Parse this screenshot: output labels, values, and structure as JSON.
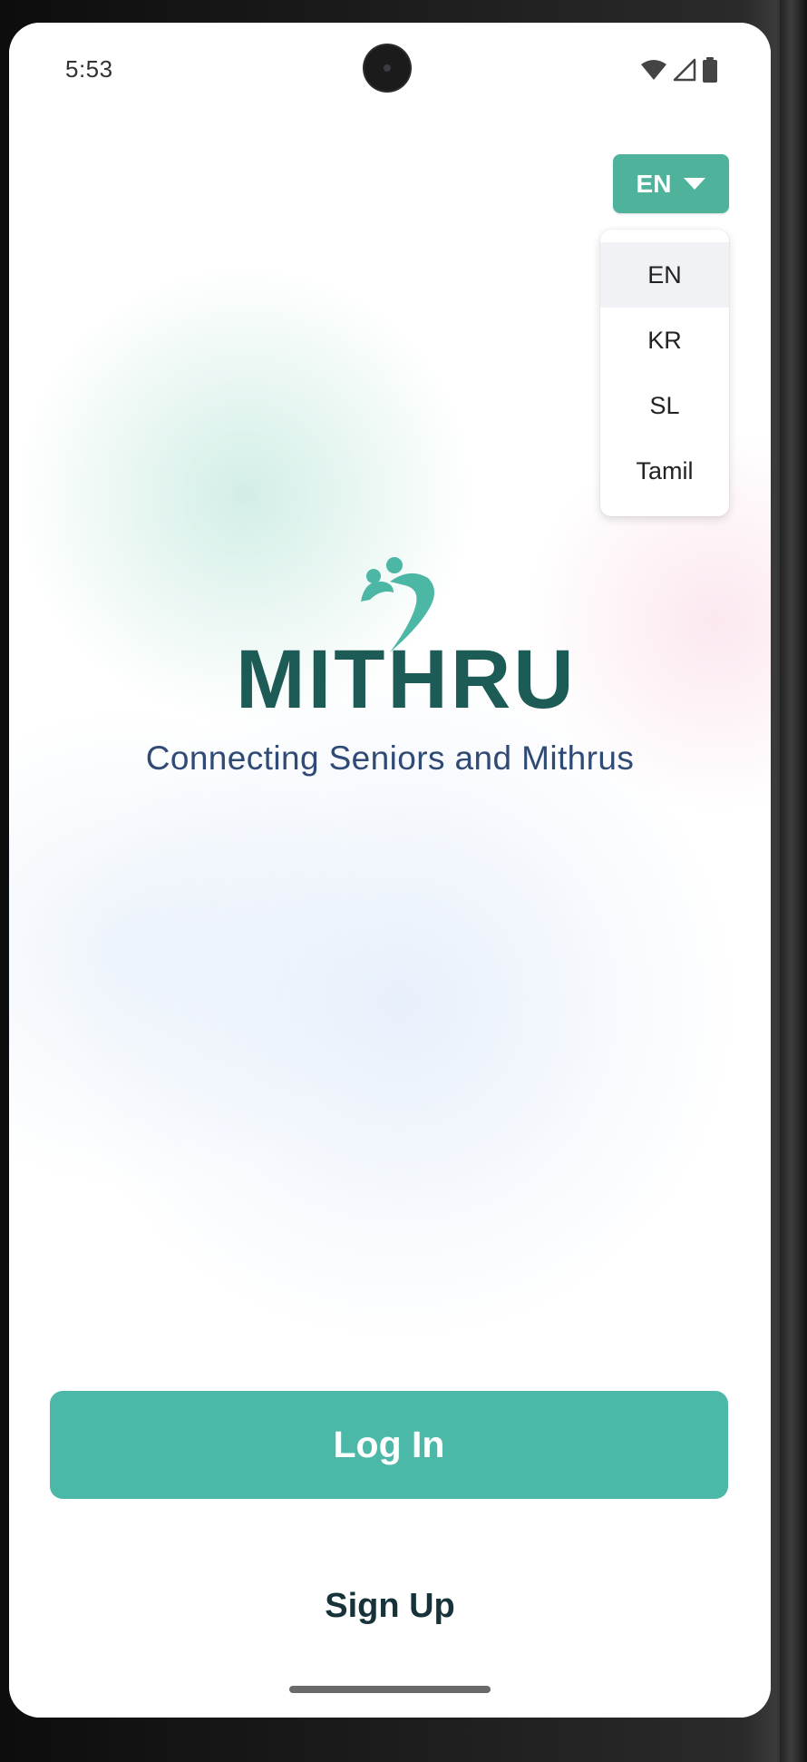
{
  "status_bar": {
    "time": "5:53",
    "icons": [
      "wifi-icon",
      "cell-signal-icon",
      "battery-icon"
    ]
  },
  "language": {
    "current": "EN",
    "options": [
      "EN",
      "KR",
      "SL",
      "Tamil"
    ],
    "selected_index": 0
  },
  "brand": {
    "logo_text": "MITHRU",
    "tagline": "Connecting Seniors and Mithrus"
  },
  "actions": {
    "login_label": "Log In",
    "signup_label": "Sign Up"
  },
  "colors": {
    "primary": "#4cb8a8",
    "logo_dark": "#1d5b57",
    "tagline": "#2f4a74",
    "signup_text": "#17333a"
  }
}
